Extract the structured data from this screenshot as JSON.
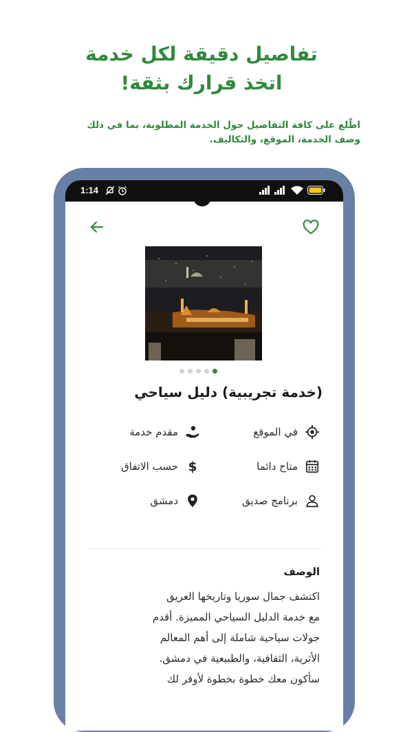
{
  "headline": {
    "line1": "تفاصيل دقيقة لكل خدمة",
    "line2": "اتخذ قرارك بثقة!"
  },
  "subline": {
    "line1": "اطّلع على كافة التفاصيل حول الخدمة المطلوبة، بما في ذلك",
    "line2": "وصف الخدمة، الموقع، والتكاليف."
  },
  "statusbar": {
    "time": "1:14",
    "icons": [
      "mute-icon",
      "alarm-icon",
      "signal-icon",
      "signal-icon",
      "wifi-icon",
      "battery-icon"
    ]
  },
  "app": {
    "nav": {
      "back_icon": "arrow-back-icon",
      "favorite_icon": "heart-icon"
    },
    "gallery": {
      "slides": 5,
      "active_index": 4
    },
    "service_title": "(خدمة تجريبية) دليل سياحي",
    "info": {
      "location_type": "في الموقع",
      "provider": "مقدم خدمة",
      "availability": "متاح دائما",
      "price": "حسب الاتفاق",
      "program": "برنامج صديق",
      "city": "دمشق"
    },
    "description": {
      "title": "الوصف",
      "line1": "اكتشف جمال سوريا وتاريخها العريق",
      "line2": "مع خدمة الدليل السياحي المميزة. أقدم",
      "line3": "جولات سياحية شاملة إلى أهم المعالم",
      "line4": "الأثرية، الثقافية، والطبيعية في دمشق.",
      "line5": "سأكون معك خطوة بخطوة لأوفر لك"
    }
  },
  "colors": {
    "accent": "#2e8a3c",
    "frame": "#687fa6"
  }
}
